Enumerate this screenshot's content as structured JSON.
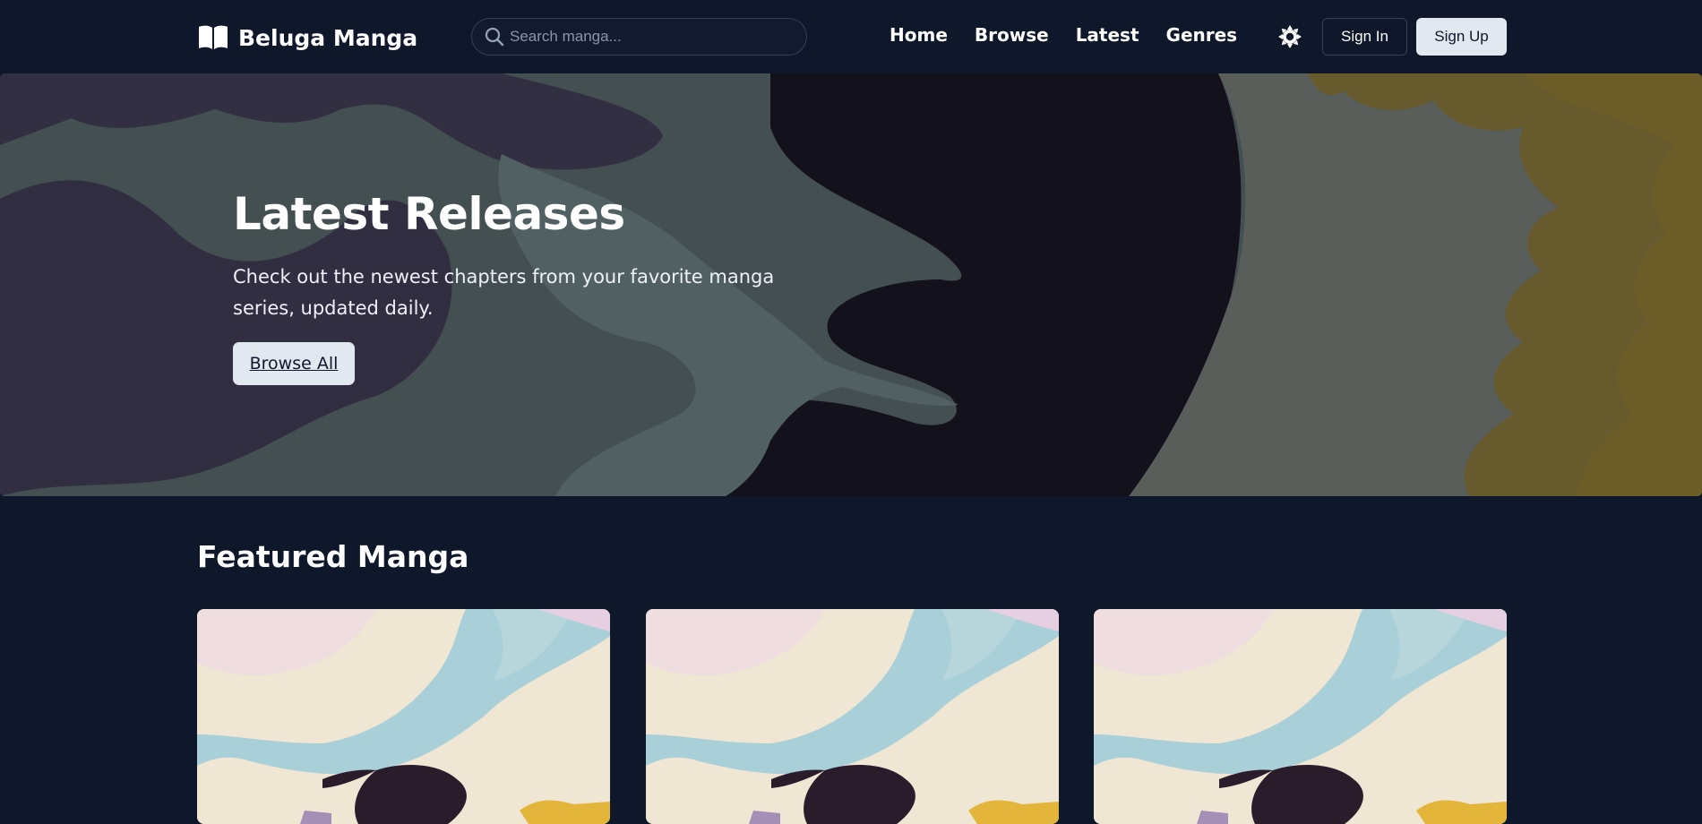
{
  "header": {
    "logo_text": "Beluga Manga",
    "logo_icon": "open-book-icon",
    "search_placeholder": "Search manga...",
    "nav": [
      {
        "label": "Home"
      },
      {
        "label": "Browse"
      },
      {
        "label": "Latest"
      },
      {
        "label": "Genres"
      }
    ],
    "theme_icon": "sun-icon",
    "sign_in": "Sign In",
    "sign_up": "Sign Up"
  },
  "hero": {
    "title": "Latest Releases",
    "description": "Check out the newest chapters from your favorite manga series, updated daily.",
    "button": "Browse All"
  },
  "featured": {
    "title": "Featured Manga",
    "cards": [
      {
        "image": "manga-cover-image"
      },
      {
        "image": "manga-cover-image"
      },
      {
        "image": "manga-cover-image"
      }
    ]
  },
  "colors": {
    "background": "#0f172a",
    "button_light": "#e2e8f0",
    "border": "#334155"
  }
}
